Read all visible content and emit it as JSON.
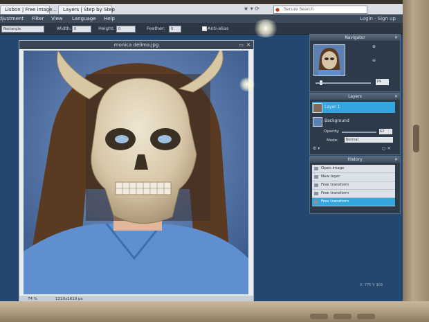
{
  "browser": {
    "tabs": [
      {
        "label": "Lisbon | Free image..."
      },
      {
        "label": "Layers | Step by Step"
      }
    ],
    "search_placeholder": "Secure Search"
  },
  "menubar": {
    "items": [
      "Adjustment",
      "Filter",
      "View",
      "Language",
      "Help"
    ],
    "right_links": "Login · Sign up"
  },
  "options": {
    "left_field": "Rectangle",
    "width_label": "Width:",
    "width_value": "0",
    "height_label": "Height:",
    "height_value": "0",
    "feather_label": "Feather:",
    "feather_value": "0",
    "antialias_label": "Anti-alias"
  },
  "document": {
    "title": "monica delima.jpg",
    "zoom": "74 %",
    "dimensions": "1210x1619 px"
  },
  "panels": {
    "navigator": {
      "title": "Navigator",
      "zoom_value": "74"
    },
    "layers": {
      "title": "Layers",
      "rows": [
        {
          "name": "Layer 1",
          "selected": true
        },
        {
          "name": "Background",
          "selected": false
        }
      ],
      "opacity_label": "Opacity:",
      "opacity_value": "62",
      "mode_label": "Mode:",
      "mode_value": "Normal"
    },
    "history": {
      "title": "History",
      "items": [
        {
          "label": "Open image"
        },
        {
          "label": "New layer"
        },
        {
          "label": "Free transform"
        },
        {
          "label": "Free transform"
        },
        {
          "label": "Free transform",
          "selected": true
        }
      ]
    }
  },
  "screen_footer": "X: 775  Y: 303",
  "colors": {
    "app_bg": "#24476f",
    "selected_blue": "#33a6e0",
    "photo_bg": "#4b6ea3",
    "shirt": "#5f8fcf"
  }
}
